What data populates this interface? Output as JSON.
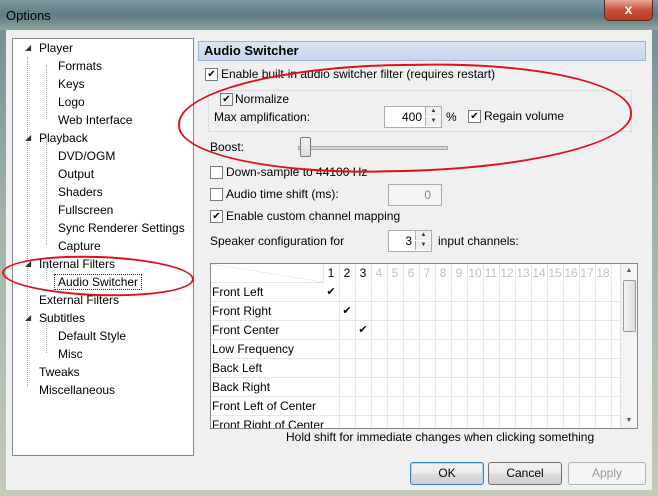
{
  "window": {
    "title": "Options",
    "close_glyph": "x"
  },
  "tree": {
    "player": "Player",
    "formats": "Formats",
    "keys": "Keys",
    "logo": "Logo",
    "web_interface": "Web Interface",
    "playback": "Playback",
    "dvd_ogm": "DVD/OGM",
    "output": "Output",
    "shaders": "Shaders",
    "fullscreen": "Fullscreen",
    "sync_renderer": "Sync Renderer Settings",
    "capture": "Capture",
    "internal_filters": "Internal Filters",
    "audio_switcher": "Audio Switcher",
    "external_filters": "External Filters",
    "subtitles": "Subtitles",
    "default_style": "Default Style",
    "misc": "Misc",
    "tweaks": "Tweaks",
    "miscellaneous": "Miscellaneous",
    "expand_glyph": "◢",
    "collapsed_glyph": "▷"
  },
  "panel": {
    "title": "Audio Switcher",
    "enable_switcher": {
      "label": "Enable built-in audio switcher filter (requires restart)",
      "checked": true
    },
    "normalize": {
      "label": "Normalize",
      "checked": true
    },
    "max_amp": {
      "label": "Max amplification:",
      "value": "400",
      "unit": "%"
    },
    "regain_volume": {
      "label": "Regain volume",
      "checked": true
    },
    "boost": {
      "label": "Boost:",
      "level": 0
    },
    "downsample": {
      "label": "Down-sample to 44100 Hz",
      "checked": false
    },
    "time_shift": {
      "label": "Audio time shift (ms):",
      "checked": false,
      "value": "0"
    },
    "custom_mapping": {
      "label": "Enable custom channel mapping",
      "checked": true
    },
    "speaker_config": {
      "label": "Speaker configuration for",
      "value": "3",
      "suffix": "input channels:"
    },
    "channel_headers": [
      "1",
      "2",
      "3",
      "4",
      "5",
      "6",
      "7",
      "8",
      "9",
      "10",
      "11",
      "12",
      "13",
      "14",
      "15",
      "16",
      "17",
      "18"
    ],
    "active_channels": 3,
    "channel_rows": [
      {
        "name": "Front Left",
        "checked_col": 1
      },
      {
        "name": "Front Right",
        "checked_col": 2
      },
      {
        "name": "Front Center",
        "checked_col": 3
      },
      {
        "name": "Low Frequency",
        "checked_col": 0
      },
      {
        "name": "Back Left",
        "checked_col": 0
      },
      {
        "name": "Back Right",
        "checked_col": 0
      },
      {
        "name": "Front Left of Center",
        "checked_col": 0
      },
      {
        "name": "Front Right of Center",
        "checked_col": 0
      }
    ],
    "check_glyph": "✔",
    "hint": "Hold shift for immediate changes when clicking something"
  },
  "buttons": {
    "ok": "OK",
    "cancel": "Cancel",
    "apply": "Apply"
  },
  "annotation_color": "#e0101a"
}
